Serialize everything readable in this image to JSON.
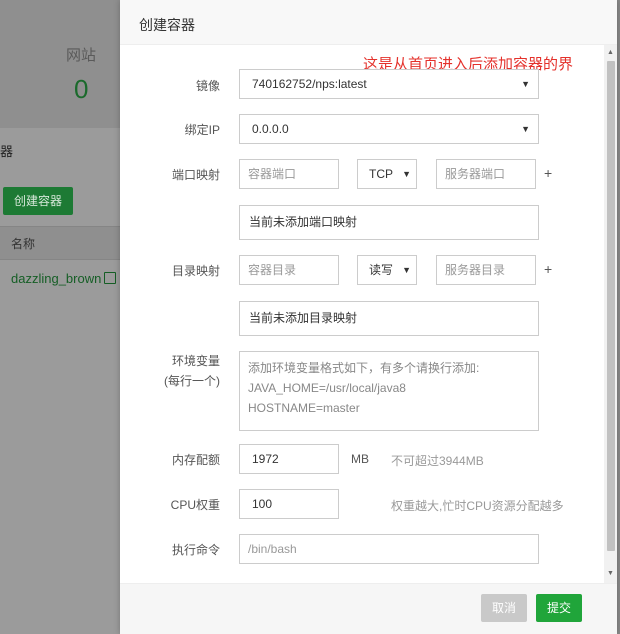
{
  "background": {
    "site_label": "网站",
    "site_count": "0",
    "section_title": "器",
    "create_button": "创建容器",
    "table_header_name": "名称",
    "row_name": "dazzling_brown"
  },
  "dialog": {
    "title": "创建容器",
    "annotation": "这是从首页进入后添加容器的界",
    "image": {
      "label": "镜像",
      "value": "740162752/nps:latest"
    },
    "bind_ip": {
      "label": "绑定IP",
      "value": "0.0.0.0"
    },
    "port_map": {
      "label": "端口映射",
      "container_port_placeholder": "容器端口",
      "protocol": "TCP",
      "server_port_placeholder": "服务器端口",
      "add": "+",
      "empty_text": "当前未添加端口映射"
    },
    "dir_map": {
      "label": "目录映射",
      "container_dir_placeholder": "容器目录",
      "mode": "读写",
      "server_dir_placeholder": "服务器目录",
      "add": "+",
      "empty_text": "当前未添加目录映射"
    },
    "env": {
      "label_line1": "环境变量",
      "label_line2": "(每行一个)",
      "placeholder_line1": "添加环境变量格式如下，有多个请换行添加:",
      "placeholder_line2": "JAVA_HOME=/usr/local/java8",
      "placeholder_line3": "HOSTNAME=master"
    },
    "memory": {
      "label": "内存配额",
      "value": "1972",
      "unit": "MB",
      "hint": "不可超过3944MB"
    },
    "cpu": {
      "label": "CPU权重",
      "value": "100",
      "hint": "权重越大,忙时CPU资源分配越多"
    },
    "command": {
      "label": "执行命令",
      "placeholder": "/bin/bash"
    },
    "cancel_button": "取消",
    "submit_button": "提交"
  },
  "colors": {
    "primary_green": "#20a53a",
    "annotation_red": "#e4312b",
    "disabled_gray": "#c9c9c9"
  }
}
